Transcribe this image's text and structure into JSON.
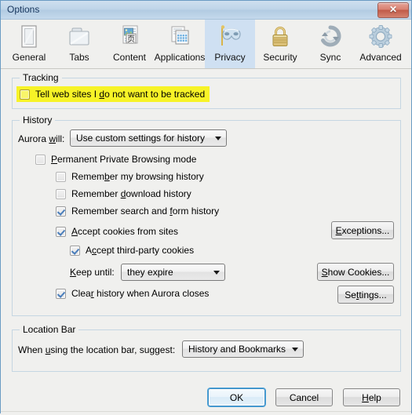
{
  "window": {
    "title": "Options",
    "close_label": "✕"
  },
  "tabs": [
    {
      "label": "General",
      "icon": "device-icon",
      "selected": false
    },
    {
      "label": "Tabs",
      "icon": "folder-tabs-icon",
      "selected": false
    },
    {
      "label": "Content",
      "icon": "content-page-icon",
      "selected": false
    },
    {
      "label": "Applications",
      "icon": "applications-icon",
      "selected": false
    },
    {
      "label": "Privacy",
      "icon": "mask-icon",
      "selected": true
    },
    {
      "label": "Security",
      "icon": "padlock-icon",
      "selected": false
    },
    {
      "label": "Sync",
      "icon": "sync-arrows-icon",
      "selected": false
    },
    {
      "label": "Advanced",
      "icon": "gear-icon",
      "selected": false
    }
  ],
  "tracking": {
    "group_title": "Tracking",
    "checkbox": {
      "label_pre": "Tell web sites I ",
      "accesskey": "d",
      "label_post": "o not want to be tracked",
      "checked": false,
      "highlighted": true
    }
  },
  "history": {
    "group_title": "History",
    "will_label_pre": "Aurora ",
    "will_accesskey": "w",
    "will_label_post": "ill:",
    "mode_value": "Use custom settings for history",
    "items": [
      {
        "pre": "",
        "ak": "P",
        "post": "ermanent Private Browsing mode",
        "checked": false,
        "indent": 0
      },
      {
        "pre": "Remem",
        "ak": "b",
        "post": "er my browsing history",
        "checked": false,
        "indent": 1
      },
      {
        "pre": "Remember ",
        "ak": "d",
        "post": "ownload history",
        "checked": false,
        "indent": 1
      },
      {
        "pre": "Remember search and ",
        "ak": "f",
        "post": "orm history",
        "checked": true,
        "indent": 1
      },
      {
        "pre": "",
        "ak": "A",
        "post": "ccept cookies from sites",
        "checked": true,
        "indent": 1
      },
      {
        "pre": "A",
        "ak": "c",
        "post": "cept third-party cookies",
        "checked": true,
        "indent": 2
      }
    ],
    "keep_until_pre": "",
    "keep_until_ak": "K",
    "keep_until_post": "eep until:",
    "keep_until_value": "they expire",
    "clear_history": {
      "pre": "Clea",
      "ak": "r",
      "post": " history when Aurora closes",
      "checked": true
    },
    "buttons": {
      "exceptions": {
        "pre": "",
        "ak": "E",
        "post": "xceptions..."
      },
      "show_cookies": {
        "pre": "",
        "ak": "S",
        "post": "how Cookies..."
      },
      "settings": {
        "pre": "Se",
        "ak": "t",
        "post": "tings..."
      }
    }
  },
  "location_bar": {
    "group_title": "Location Bar",
    "label_pre": "When ",
    "label_ak": "u",
    "label_post": "sing the location bar, suggest:",
    "value": "History and Bookmarks"
  },
  "footer": {
    "ok": {
      "pre": "OK",
      "ak": "",
      "post": ""
    },
    "cancel": {
      "pre": "Cancel",
      "ak": "",
      "post": ""
    },
    "help": {
      "pre": "",
      "ak": "H",
      "post": "elp"
    }
  },
  "colors": {
    "highlight": "#f7f327",
    "titlebar": "#bed4e8",
    "tab_selected": "#cfe0f2",
    "group_border": "#c5d6e2",
    "check_mark": "#4a7ebb",
    "close_button": "#c05a48"
  }
}
